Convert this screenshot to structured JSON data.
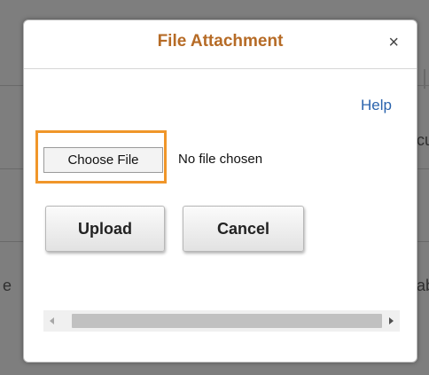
{
  "dialog": {
    "title": "File Attachment",
    "close_glyph": "×",
    "help_label": "Help",
    "choose_file_label": "Choose File",
    "file_status": "No file chosen",
    "upload_label": "Upload",
    "cancel_label": "Cancel"
  },
  "background": {
    "fragments": [
      "e",
      "cu",
      "ab"
    ]
  },
  "colors": {
    "title": "#b66b26",
    "focus_ring": "#f0962a",
    "link": "#2a63ad"
  },
  "icons": {
    "close": "close-icon",
    "scroll_left": "chevron-left-icon",
    "scroll_right": "chevron-right-icon"
  }
}
